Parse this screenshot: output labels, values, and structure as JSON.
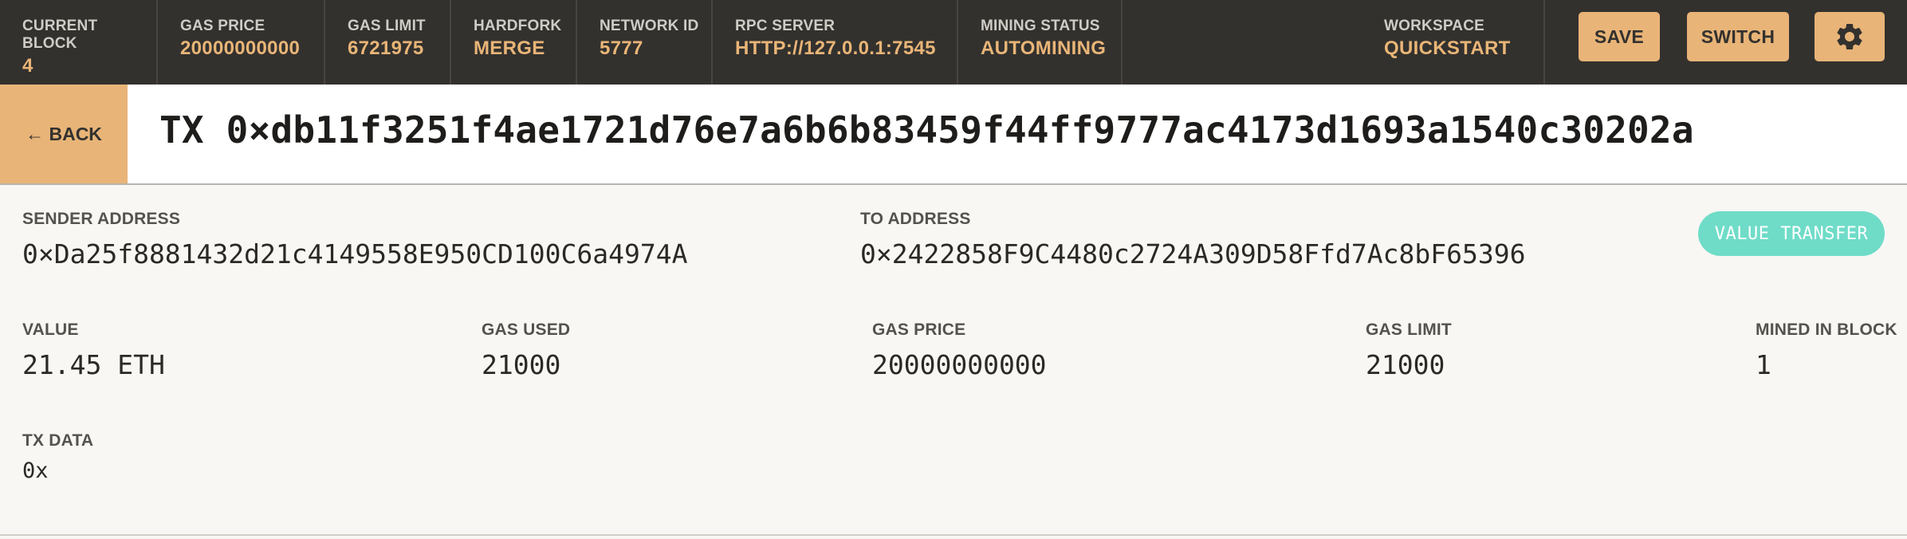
{
  "topbar": {
    "stats": [
      {
        "label": "CURRENT BLOCK",
        "value": "4"
      },
      {
        "label": "GAS PRICE",
        "value": "20000000000"
      },
      {
        "label": "GAS LIMIT",
        "value": "6721975"
      },
      {
        "label": "HARDFORK",
        "value": "MERGE"
      },
      {
        "label": "NETWORK ID",
        "value": "5777"
      },
      {
        "label": "RPC SERVER",
        "value": "HTTP://127.0.0.1:7545"
      },
      {
        "label": "MINING STATUS",
        "value": "AUTOMINING"
      }
    ],
    "workspace": {
      "label": "WORKSPACE",
      "value": "QUICKSTART"
    },
    "save_label": "SAVE",
    "switch_label": "SWITCH",
    "settings_icon": "gear-icon"
  },
  "title": {
    "back_label": "← BACK",
    "tx_title": "TX 0×db11f3251f4ae1721d76e7a6b6b83459f44ff9777ac4173d1693a1540c30202a"
  },
  "details": {
    "sender": {
      "label": "SENDER ADDRESS",
      "value": "0×Da25f8881432d21c4149558E950CD100C6a4974A"
    },
    "to": {
      "label": "TO ADDRESS",
      "value": "0×2422858F9C4480c2724A309D58Ffd7Ac8bF65396"
    },
    "badge": "VALUE TRANSFER",
    "value": {
      "label": "VALUE",
      "value": "21.45 ETH"
    },
    "gas_used": {
      "label": "GAS USED",
      "value": "21000"
    },
    "gas_price": {
      "label": "GAS PRICE",
      "value": "20000000000"
    },
    "gas_limit": {
      "label": "GAS LIMIT",
      "value": "21000"
    },
    "mined_in_block": {
      "label": "MINED IN BLOCK",
      "value": "1"
    },
    "tx_data": {
      "label": "TX DATA",
      "value": "0x"
    }
  },
  "colors": {
    "topbar_bg": "#33312e",
    "accent": "#e8b478",
    "accent_text": "#e9b577",
    "badge": "#6fdcc8",
    "page_bg": "#f8f7f4"
  }
}
